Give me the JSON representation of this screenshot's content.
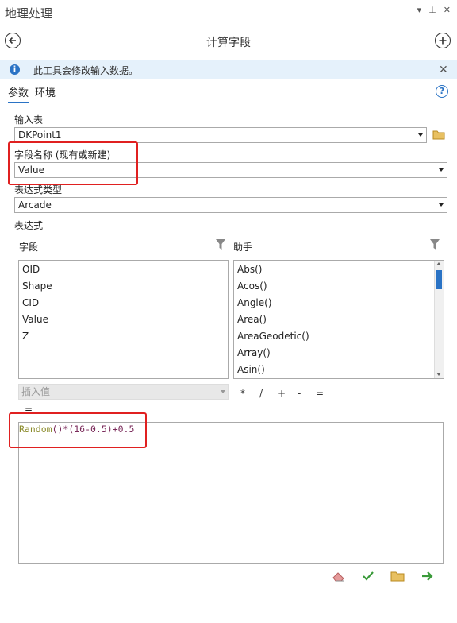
{
  "pane": {
    "title": "地理处理",
    "controls": [
      "▾",
      "⊥",
      "✕"
    ]
  },
  "tool": {
    "title": "计算字段"
  },
  "banner": {
    "text": "此工具会修改输入数据。"
  },
  "tabs": [
    {
      "label": "参数",
      "active": true
    },
    {
      "label": "环境",
      "active": false
    }
  ],
  "params": {
    "input_table": {
      "label": "输入表",
      "value": "DKPoint1"
    },
    "field_name": {
      "label": "字段名称 (现有或新建)",
      "value": "Value"
    },
    "expr_type": {
      "label": "表达式类型",
      "value": "Arcade"
    },
    "expression": {
      "label": "表达式"
    }
  },
  "fields_panel": {
    "header": "字段",
    "items": [
      "OID",
      "Shape",
      "CID",
      "Value",
      "Z"
    ]
  },
  "helpers_panel": {
    "header": "助手",
    "items": [
      "Abs()",
      "Acos()",
      "Angle()",
      "Area()",
      "AreaGeodetic()",
      "Array()",
      "Asin()"
    ]
  },
  "insert_value": {
    "placeholder": "插入值"
  },
  "operators": [
    "*",
    "/",
    "+",
    "-",
    "="
  ],
  "equals_label": "=",
  "code": {
    "func": "Random",
    "rest_a": "()*(16-0.5)+0.5"
  },
  "colors": {
    "accent": "#2a73c5",
    "highlight": "#e02020",
    "banner_bg": "#e5f1fb"
  }
}
